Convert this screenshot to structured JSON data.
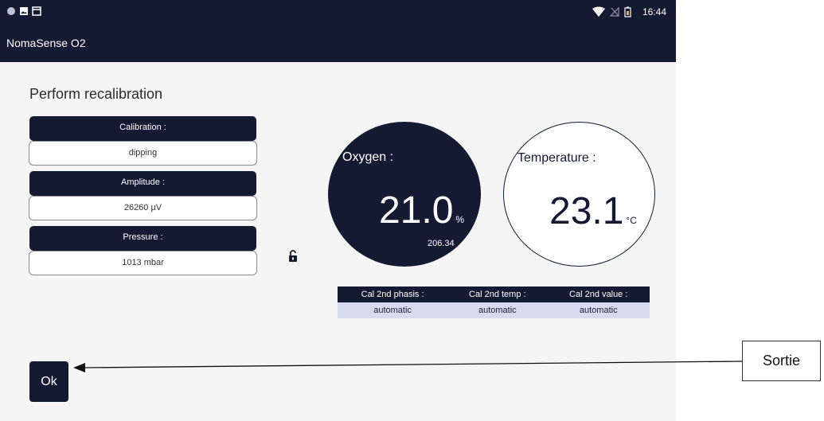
{
  "status_bar": {
    "time": "16:44",
    "left_icons": [
      "circle-dot-icon",
      "image-icon",
      "calendar-icon"
    ],
    "right_icons": [
      "wifi-icon",
      "no-signal-icon",
      "battery-icon"
    ]
  },
  "app_bar": {
    "title": "NomaSense O2"
  },
  "page": {
    "title": "Perform recalibration",
    "fields": [
      {
        "label": "Calibration :",
        "value": "dipping"
      },
      {
        "label": "Amplitude :",
        "value": "26260 µV"
      },
      {
        "label": "Pressure :",
        "value": "1013 mbar"
      }
    ],
    "lock_icon": "lock-open-icon"
  },
  "oxygen": {
    "label": "Oxygen :",
    "value": "21.0",
    "unit": "%",
    "sub_value": "206.34"
  },
  "temperature": {
    "label": "Temperature :",
    "value": "23.1",
    "unit": "°C"
  },
  "cal_table": {
    "headers": [
      "Cal 2nd phasis :",
      "Cal 2nd temp :",
      "Cal 2nd value :"
    ],
    "values": [
      "automatic",
      "automatic",
      "automatic"
    ]
  },
  "ok_button": {
    "label": "Ok"
  },
  "annotation": {
    "label": "Sortie"
  },
  "colors": {
    "primary": "#151a33",
    "background": "#f5f5f5",
    "table_row": "#d6dbef"
  }
}
